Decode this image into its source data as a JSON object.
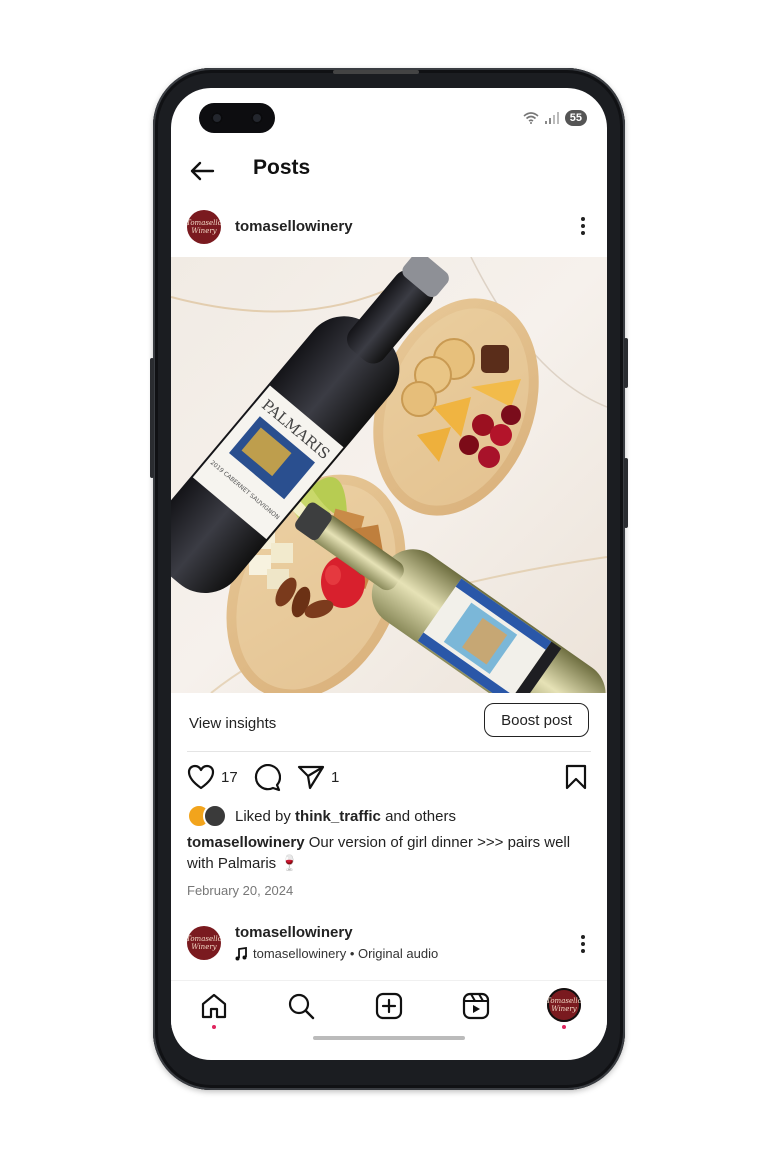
{
  "status_bar": {
    "battery": "55",
    "icons": [
      "wifi-icon",
      "signal-icon"
    ]
  },
  "header": {
    "title": "Posts",
    "back_icon": "arrow-left-icon"
  },
  "post": {
    "username": "tomasellowinery",
    "avatar_text": "Tomasello Winery",
    "more_icon": "more-vertical-icon",
    "image": {
      "description_icon": "wine-and-cheese-photo",
      "bottle_left_label": "PALMARIS",
      "bottle_left_detail": "2019 CABERNET SAUVIGNON"
    },
    "view_insights_label": "View insights",
    "boost_label": "Boost post",
    "likes_count": "17",
    "shares_count": "1",
    "liked_by_prefix": "Liked by",
    "liked_by_user": "think_traffic",
    "liked_by_suffix": "and others",
    "caption_user": "tomasellowinery",
    "caption_text": "Our version of girl dinner >>> pairs well with Palmaris 🍷",
    "date": "February 20, 2024"
  },
  "next_post": {
    "username": "tomasellowinery",
    "audio_text": "tomasellowinery • Original audio"
  },
  "bottom_nav": [
    "home-icon",
    "search-icon",
    "create-icon",
    "reels-icon",
    "profile-avatar"
  ],
  "colors": {
    "brand_maroon": "#7a1a1f",
    "notification_red": "#e0245e",
    "text": "#222222"
  }
}
